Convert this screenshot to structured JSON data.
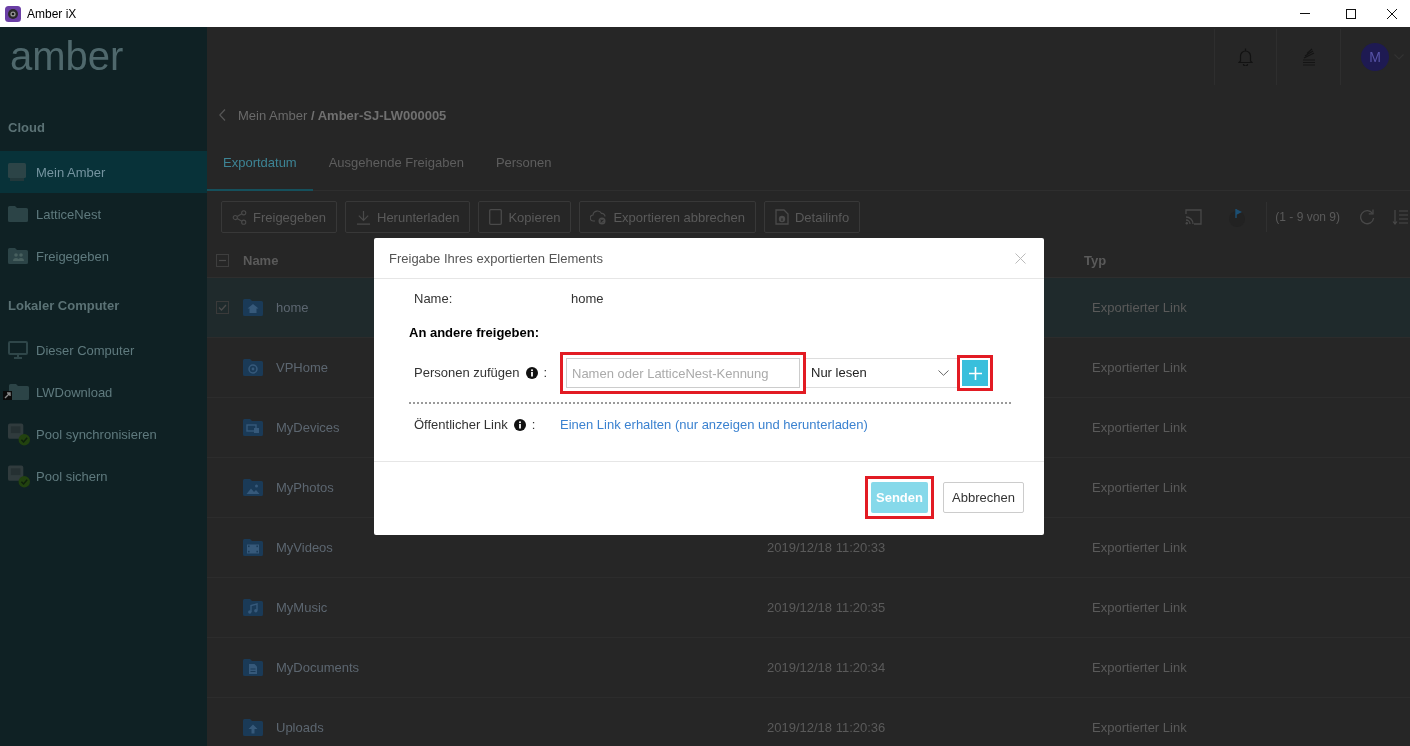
{
  "window": {
    "title": "Amber iX"
  },
  "sidebar": {
    "logo": "amber",
    "sections": [
      {
        "heading": "Cloud",
        "items": [
          {
            "label": "Mein Amber",
            "kind": "device",
            "selected": true
          },
          {
            "label": "LatticeNest",
            "kind": "folder",
            "selected": false
          },
          {
            "label": "Freigegeben",
            "kind": "shared",
            "selected": false
          }
        ]
      },
      {
        "heading": "Lokaler Computer",
        "items": [
          {
            "label": "Dieser Computer",
            "kind": "computer",
            "selected": false
          },
          {
            "label": "LWDownload",
            "kind": "shortcut",
            "selected": false
          },
          {
            "label": "Pool synchronisieren",
            "kind": "pool",
            "selected": false
          },
          {
            "label": "Pool sichern",
            "kind": "pool",
            "selected": false
          }
        ]
      }
    ]
  },
  "header": {
    "avatar": "M"
  },
  "breadcrumb": {
    "path": "Mein Amber **/ Amber-SJ-LW000005**"
  },
  "tabs": [
    {
      "label": "Exportdatum",
      "selected": true
    },
    {
      "label": "Ausgehende Freigaben",
      "selected": false
    },
    {
      "label": "Personen",
      "selected": false
    }
  ],
  "toolbar": {
    "buttons": [
      {
        "label": "Freigegeben",
        "kind": "share"
      },
      {
        "label": "Herunterladen",
        "kind": "download"
      },
      {
        "label": "Kopieren",
        "kind": "copy"
      },
      {
        "label": "Exportieren abbrechen",
        "kind": "cancel-export"
      },
      {
        "label": "Detailinfo",
        "kind": "details"
      }
    ],
    "count": "(1 - 9 von 9)"
  },
  "table": {
    "header_checkbox": {
      "checked": false,
      "indeterminate": true
    },
    "columns": [
      "Name",
      "Typ"
    ],
    "rows": [
      {
        "name": "home",
        "kind": "home",
        "selected": true,
        "type": "Exportierter Link"
      },
      {
        "name": "VPHome",
        "kind": "vphome",
        "selected": false,
        "type": "Exportierter Link"
      },
      {
        "name": "MyDevices",
        "kind": "devices",
        "selected": false,
        "type": "Exportierter Link"
      },
      {
        "name": "MyPhotos",
        "kind": "photos",
        "selected": false,
        "type": "Exportierter Link"
      },
      {
        "name": "MyVideos",
        "kind": "videos",
        "selected": false,
        "date": "2019/12/18 11:20:33",
        "type": "Exportierter Link"
      },
      {
        "name": "MyMusic",
        "kind": "music",
        "selected": false,
        "date": "2019/12/18 11:20:35",
        "type": "Exportierter Link"
      },
      {
        "name": "MyDocuments",
        "kind": "documents",
        "selected": false,
        "date": "2019/12/18 11:20:34",
        "type": "Exportierter Link"
      },
      {
        "name": "Uploads",
        "kind": "uploads",
        "selected": false,
        "date": "2019/12/18 11:20:36",
        "type": "Exportierter Link"
      }
    ]
  },
  "dialog": {
    "title": "Freigabe Ihres exportierten Elements",
    "name_label": "Name:",
    "name_value": "home",
    "section_title": "An andere freigeben:",
    "add_people": {
      "label": "Personen zufügen",
      "colon": ":",
      "placeholder": "Namen oder LatticeNest-Kennung",
      "input_highlighted": true,
      "permission": "Nur lesen",
      "add_highlighted": true
    },
    "public_link": {
      "label": "Öffentlicher Link",
      "colon": ":",
      "link": "Einen Link erhalten (nur anzeigen und herunterladen)"
    },
    "buttons": [
      {
        "label": "Senden",
        "kind": "primary",
        "disabled": true,
        "highlighted": true
      },
      {
        "label": "Abbrechen",
        "kind": "secondary",
        "disabled": false,
        "highlighted": false
      }
    ]
  }
}
